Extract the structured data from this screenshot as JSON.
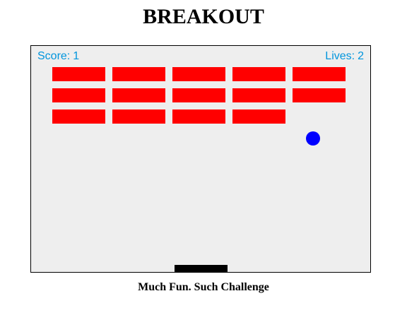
{
  "title": "BREAKOUT",
  "hud": {
    "score_label": "Score:",
    "score_value": "1",
    "lives_label": "Lives:",
    "lives_value": "2"
  },
  "bricks": {
    "columns_per_row": [
      5,
      5,
      4
    ],
    "color": "#ff0000"
  },
  "ball": {
    "color": "#0000ff"
  },
  "paddle": {
    "color": "#000000"
  },
  "board": {
    "background": "#eeeeee",
    "hud_color": "#0095dd"
  },
  "caption": "Much Fun. Such Challenge"
}
